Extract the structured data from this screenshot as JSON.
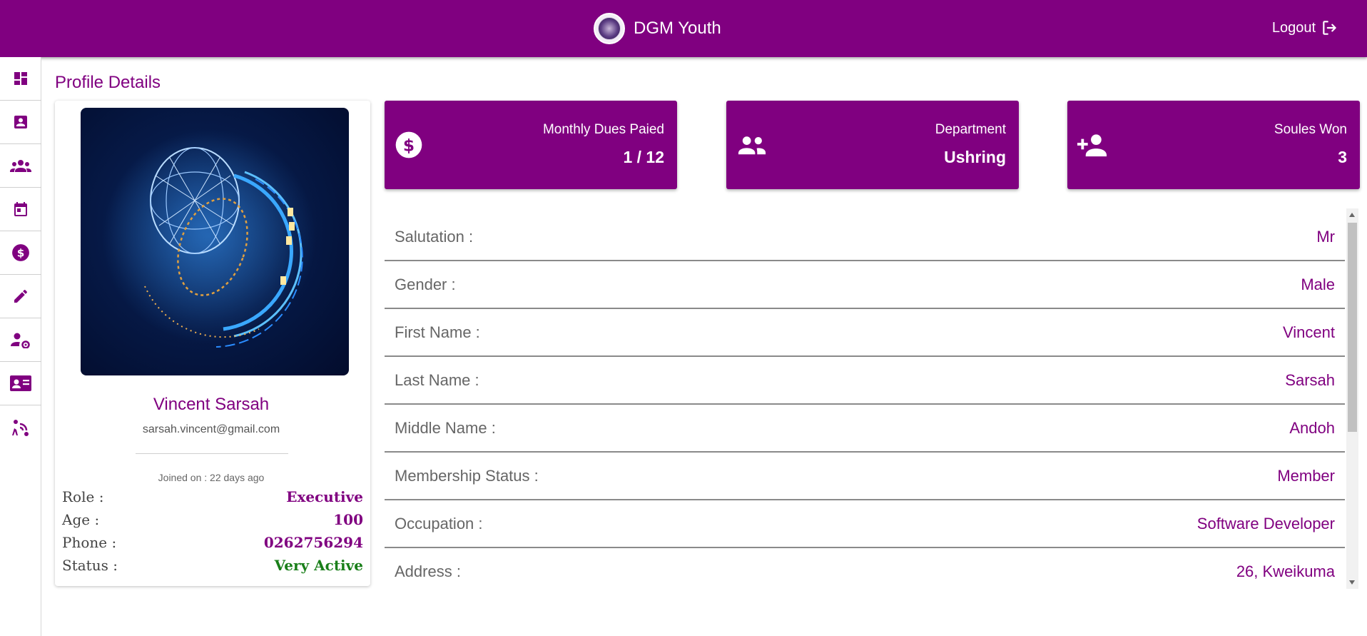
{
  "header": {
    "title": "DGM Youth",
    "logout_label": "Logout",
    "logo_icon": "church-seal-logo"
  },
  "sidebar": {
    "items": [
      {
        "name": "dashboard",
        "icon": "dashboard-icon"
      },
      {
        "name": "profile",
        "icon": "contact-card-icon"
      },
      {
        "name": "members",
        "icon": "groups-icon"
      },
      {
        "name": "events",
        "icon": "calendar-icon"
      },
      {
        "name": "dues",
        "icon": "dollar-icon"
      },
      {
        "name": "edit",
        "icon": "pencil-icon"
      },
      {
        "name": "user-settings",
        "icon": "user-gear-icon"
      },
      {
        "name": "id-card",
        "icon": "id-card-icon"
      },
      {
        "name": "broadcast",
        "icon": "person-wifi-icon"
      }
    ]
  },
  "page": {
    "title": "Profile Details"
  },
  "profile": {
    "name": "Vincent Sarsah",
    "email": "sarsah.vincent@gmail.com",
    "joined": "Joined on : 22 days ago",
    "info": [
      {
        "key": "Role :",
        "value": "Executive"
      },
      {
        "key": "Age :",
        "value": "100"
      },
      {
        "key": "Phone :",
        "value": "0262756294"
      },
      {
        "key": "Status :",
        "value": "Very Active"
      }
    ]
  },
  "stats": [
    {
      "label": "Monthly Dues Paied",
      "value": "1 / 12",
      "icon": "dollar-circle-icon"
    },
    {
      "label": "Department",
      "value": "Ushring",
      "icon": "people-icon"
    },
    {
      "label": "Soules Won",
      "value": "3",
      "icon": "person-add-icon"
    }
  ],
  "details": [
    {
      "key": "Salutation :",
      "value": "Mr"
    },
    {
      "key": "Gender :",
      "value": "Male"
    },
    {
      "key": "First Name :",
      "value": "Vincent"
    },
    {
      "key": "Last Name :",
      "value": "Sarsah"
    },
    {
      "key": "Middle Name :",
      "value": "Andoh"
    },
    {
      "key": "Membership Status :",
      "value": "Member"
    },
    {
      "key": "Occupation :",
      "value": "Software Developer"
    },
    {
      "key": "Address :",
      "value": "26, Kweikuma"
    }
  ],
  "colors": {
    "brand": "#800080",
    "status_active": "#1a7f1a"
  }
}
